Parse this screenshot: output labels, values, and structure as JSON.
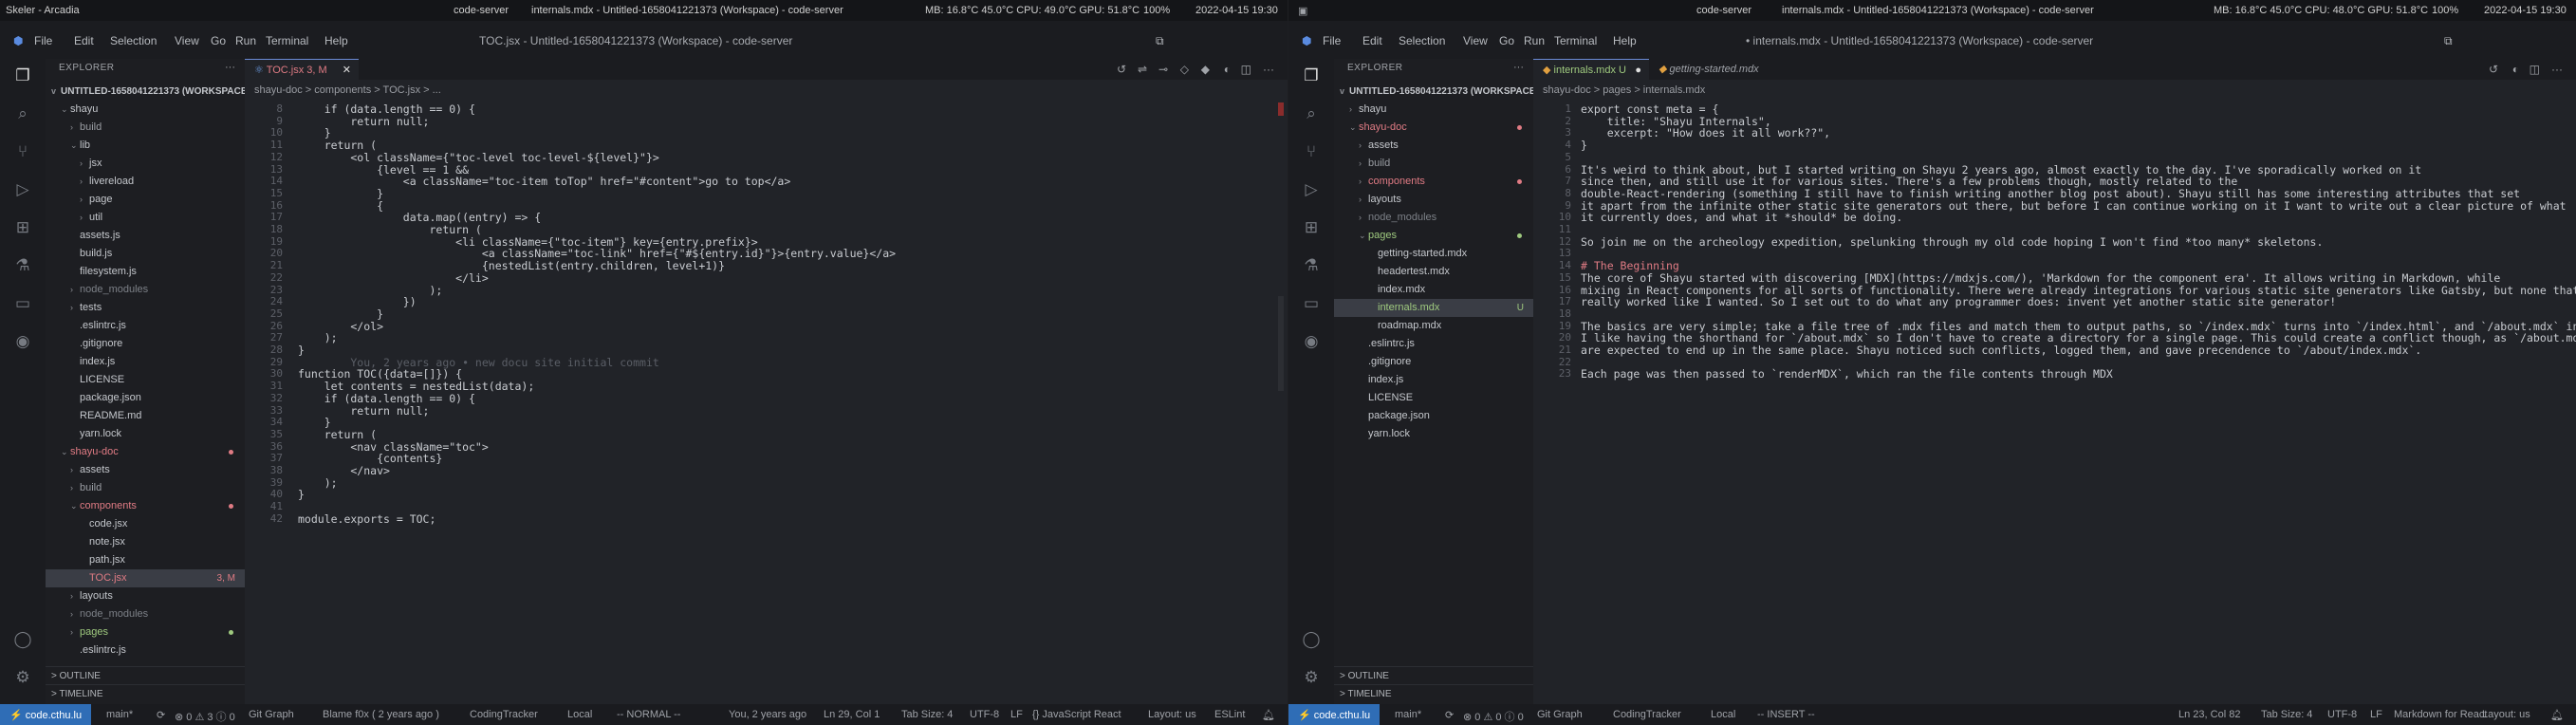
{
  "left": {
    "topbar": {
      "app": "Skeler - Arcadia",
      "window": "code-server",
      "tab_title": "internals.mdx - Untitled-1658041221373 (Workspace) - code-server",
      "stats": "MB: 16.8°C 45.0°C CPU: 49.0°C GPU: 51.8°C",
      "battery": "100%",
      "datetime": "2022-04-15 19:30"
    },
    "menu": [
      "File",
      "Edit",
      "Selection",
      "View",
      "Go",
      "Run",
      "Terminal",
      "Help"
    ],
    "window_title": "TOC.jsx - Untitled-1658041221373 (Workspace) - code-server",
    "explorer": {
      "label": "EXPLORER",
      "workspace": "UNTITLED-1658041221373 (WORKSPACE)"
    },
    "tree": [
      {
        "name": "shayu",
        "indent": 1,
        "tw": "v",
        "color": "#c4c7cc"
      },
      {
        "name": "build",
        "indent": 2,
        "tw": ">",
        "color": "#9a9da3"
      },
      {
        "name": "lib",
        "indent": 2,
        "tw": "v",
        "color": "#c4c7cc"
      },
      {
        "name": "jsx",
        "indent": 3,
        "tw": ">",
        "color": "#c4c7cc"
      },
      {
        "name": "livereload",
        "indent": 3,
        "tw": ">",
        "color": "#c4c7cc"
      },
      {
        "name": "page",
        "indent": 3,
        "tw": ">",
        "color": "#c4c7cc"
      },
      {
        "name": "util",
        "indent": 3,
        "tw": ">",
        "color": "#c4c7cc"
      },
      {
        "name": "assets.js",
        "indent": 2,
        "tw": "",
        "color": "#c4c7cc"
      },
      {
        "name": "build.js",
        "indent": 2,
        "tw": "",
        "color": "#c4c7cc"
      },
      {
        "name": "filesystem.js",
        "indent": 2,
        "tw": "",
        "color": "#c4c7cc"
      },
      {
        "name": "node_modules",
        "indent": 2,
        "tw": ">",
        "color": "#7c8087"
      },
      {
        "name": "tests",
        "indent": 2,
        "tw": ">",
        "color": "#c4c7cc"
      },
      {
        "name": ".eslintrc.js",
        "indent": 2,
        "tw": "",
        "color": "#c4c7cc"
      },
      {
        "name": ".gitignore",
        "indent": 2,
        "tw": "",
        "color": "#c4c7cc"
      },
      {
        "name": "index.js",
        "indent": 2,
        "tw": "",
        "color": "#c4c7cc"
      },
      {
        "name": "LICENSE",
        "indent": 2,
        "tw": "",
        "color": "#c4c7cc"
      },
      {
        "name": "package.json",
        "indent": 2,
        "tw": "",
        "color": "#c4c7cc"
      },
      {
        "name": "README.md",
        "indent": 2,
        "tw": "",
        "color": "#c4c7cc"
      },
      {
        "name": "yarn.lock",
        "indent": 2,
        "tw": "",
        "color": "#c4c7cc"
      },
      {
        "name": "shayu-doc",
        "indent": 1,
        "tw": "v",
        "color": "#e07b84",
        "dot": "#e07b84"
      },
      {
        "name": "assets",
        "indent": 2,
        "tw": ">",
        "color": "#c4c7cc"
      },
      {
        "name": "build",
        "indent": 2,
        "tw": ">",
        "color": "#9a9da3"
      },
      {
        "name": "components",
        "indent": 2,
        "tw": "v",
        "color": "#e07b84",
        "dot": "#e07b84"
      },
      {
        "name": "code.jsx",
        "indent": 3,
        "tw": "",
        "color": "#c4c7cc"
      },
      {
        "name": "note.jsx",
        "indent": 3,
        "tw": "",
        "color": "#c4c7cc"
      },
      {
        "name": "path.jsx",
        "indent": 3,
        "tw": "",
        "color": "#c4c7cc"
      },
      {
        "name": "TOC.jsx",
        "indent": 3,
        "tw": "",
        "color": "#e07b84",
        "badge": "3, M",
        "sel": true
      },
      {
        "name": "layouts",
        "indent": 2,
        "tw": ">",
        "color": "#c4c7cc"
      },
      {
        "name": "node_modules",
        "indent": 2,
        "tw": ">",
        "color": "#7c8087"
      },
      {
        "name": "pages",
        "indent": 2,
        "tw": ">",
        "color": "#9fca7f",
        "dot": "#9fca7f"
      },
      {
        "name": ".eslintrc.js",
        "indent": 2,
        "tw": "",
        "color": "#c4c7cc"
      }
    ],
    "outline": "OUTLINE",
    "timeline": "TIMELINE",
    "tab_active": "TOC.jsx 3, M",
    "breadcrumb": "shayu-doc > components > TOC.jsx > ...",
    "code": [
      {
        "n": "8",
        "t": "    if (data.length == 0) {"
      },
      {
        "n": "9",
        "t": "        return null;"
      },
      {
        "n": "10",
        "t": "    }"
      },
      {
        "n": "11",
        "t": "    return ("
      },
      {
        "n": "12",
        "t": "        <ol className={\"toc-level toc-level-${level}\"}>"
      },
      {
        "n": "13",
        "t": "            {level == 1 &&"
      },
      {
        "n": "14",
        "t": "                <a className=\"toc-item toTop\" href=\"#content\">go to top</a>"
      },
      {
        "n": "15",
        "t": "            }"
      },
      {
        "n": "16",
        "t": "            {"
      },
      {
        "n": "17",
        "t": "                data.map((entry) => {"
      },
      {
        "n": "18",
        "t": "                    return ("
      },
      {
        "n": "19",
        "t": "                        <li className={\"toc-item\"} key={entry.prefix}>"
      },
      {
        "n": "20",
        "t": "                            <a className=\"toc-link\" href={\"#${entry.id}\"}>{entry.value}</a>"
      },
      {
        "n": "21",
        "t": "                            {nestedList(entry.children, level+1)}"
      },
      {
        "n": "22",
        "t": "                        </li>"
      },
      {
        "n": "23",
        "t": "                    );"
      },
      {
        "n": "24",
        "t": "                })"
      },
      {
        "n": "25",
        "t": "            }"
      },
      {
        "n": "26",
        "t": "        </ol>"
      },
      {
        "n": "27",
        "t": "    );"
      },
      {
        "n": "28",
        "t": "}"
      },
      {
        "n": "29",
        "t": "        You, 2 years ago • new docu site initial commit",
        "blame": true
      },
      {
        "n": "30",
        "t": "function TOC({data=[]}) {"
      },
      {
        "n": "31",
        "t": "    let contents = nestedList(data);"
      },
      {
        "n": "32",
        "t": "    if (data.length == 0) {"
      },
      {
        "n": "33",
        "t": "        return null;"
      },
      {
        "n": "34",
        "t": "    }"
      },
      {
        "n": "35",
        "t": "    return ("
      },
      {
        "n": "36",
        "t": "        <nav className=\"toc\">"
      },
      {
        "n": "37",
        "t": "            {contents}"
      },
      {
        "n": "38",
        "t": "        </nav>"
      },
      {
        "n": "39",
        "t": "    );"
      },
      {
        "n": "40",
        "t": "}"
      },
      {
        "n": "41",
        "t": ""
      },
      {
        "n": "42",
        "t": "module.exports = TOC;"
      }
    ],
    "status": [
      "main*",
      "⊗ 0 ⚠ 3 ⓘ 0",
      "Git Graph",
      "Blame f0x ( 2 years ago )",
      "CodingTracker",
      "Local",
      "-- NORMAL --",
      "You, 2 years ago",
      "Ln 29, Col 1",
      "Tab Size: 4",
      "UTF-8",
      "LF",
      "{} JavaScript React",
      "Layout: us",
      "ESLint"
    ],
    "remote": "⚡ code.cthu.lu"
  },
  "right": {
    "topbar": {
      "window": "code-server",
      "tab_title": "internals.mdx - Untitled-1658041221373 (Workspace) - code-server",
      "stats": "MB: 16.8°C 45.0°C CPU: 48.0°C GPU: 51.8°C",
      "battery": "100%",
      "datetime": "2022-04-15 19:30"
    },
    "menu": [
      "File",
      "Edit",
      "Selection",
      "View",
      "Go",
      "Run",
      "Terminal",
      "Help"
    ],
    "window_title": "• internals.mdx - Untitled-1658041221373 (Workspace) - code-server",
    "explorer": {
      "label": "EXPLORER",
      "workspace": "UNTITLED-1658041221373 (WORKSPACE)"
    },
    "tree": [
      {
        "name": "shayu",
        "indent": 1,
        "tw": ">",
        "color": "#c4c7cc"
      },
      {
        "name": "shayu-doc",
        "indent": 1,
        "tw": "v",
        "color": "#e07b84",
        "dot": "#e07b84"
      },
      {
        "name": "assets",
        "indent": 2,
        "tw": ">",
        "color": "#c4c7cc"
      },
      {
        "name": "build",
        "indent": 2,
        "tw": ">",
        "color": "#9a9da3"
      },
      {
        "name": "components",
        "indent": 2,
        "tw": ">",
        "color": "#e07b84",
        "dot": "#e07b84"
      },
      {
        "name": "layouts",
        "indent": 2,
        "tw": ">",
        "color": "#c4c7cc"
      },
      {
        "name": "node_modules",
        "indent": 2,
        "tw": ">",
        "color": "#7c8087"
      },
      {
        "name": "pages",
        "indent": 2,
        "tw": "v",
        "color": "#9fca7f",
        "dot": "#9fca7f"
      },
      {
        "name": "getting-started.mdx",
        "indent": 3,
        "tw": "",
        "color": "#c4c7cc"
      },
      {
        "name": "headertest.mdx",
        "indent": 3,
        "tw": "",
        "color": "#c4c7cc"
      },
      {
        "name": "index.mdx",
        "indent": 3,
        "tw": "",
        "color": "#c4c7cc"
      },
      {
        "name": "internals.mdx",
        "indent": 3,
        "tw": "",
        "color": "#9fca7f",
        "badge": "U",
        "sel": true
      },
      {
        "name": "roadmap.mdx",
        "indent": 3,
        "tw": "",
        "color": "#c4c7cc"
      },
      {
        "name": ".eslintrc.js",
        "indent": 2,
        "tw": "",
        "color": "#c4c7cc"
      },
      {
        "name": ".gitignore",
        "indent": 2,
        "tw": "",
        "color": "#c4c7cc"
      },
      {
        "name": "index.js",
        "indent": 2,
        "tw": "",
        "color": "#c4c7cc"
      },
      {
        "name": "LICENSE",
        "indent": 2,
        "tw": "",
        "color": "#c4c7cc"
      },
      {
        "name": "package.json",
        "indent": 2,
        "tw": "",
        "color": "#c4c7cc"
      },
      {
        "name": "yarn.lock",
        "indent": 2,
        "tw": "",
        "color": "#c4c7cc"
      }
    ],
    "outline": "OUTLINE",
    "timeline": "TIMELINE",
    "tab_active": "internals.mdx U",
    "tab_other": "getting-started.mdx",
    "breadcrumb": "shayu-doc > pages > internals.mdx",
    "code": [
      {
        "n": "1",
        "t": "export const meta = {"
      },
      {
        "n": "2",
        "t": "    title: \"Shayu Internals\","
      },
      {
        "n": "3",
        "t": "    excerpt: \"How does it all work??\","
      },
      {
        "n": "4",
        "t": "}"
      },
      {
        "n": "5",
        "t": ""
      },
      {
        "n": "6",
        "t": "It's weird to think about, but I started writing on Shayu 2 years ago, almost exactly to the day. I've sporadically worked on it"
      },
      {
        "n": "7",
        "t": "since then, and still use it for various sites. There's a few problems though, mostly related to the"
      },
      {
        "n": "8",
        "t": "double-React-rendering (something I still have to finish writing another blog post about). Shayu still has some interesting attributes that set"
      },
      {
        "n": "9",
        "t": "it apart from the infinite other static site generators out there, but before I can continue working on it I want to write out a clear picture of what"
      },
      {
        "n": "10",
        "t": "it currently does, and what it *should* be doing."
      },
      {
        "n": "11",
        "t": ""
      },
      {
        "n": "12",
        "t": "So join me on the archeology expedition, spelunking through my old code hoping I won't find *too many* skeletons."
      },
      {
        "n": "13",
        "t": ""
      },
      {
        "n": "14",
        "t": "# The Beginning"
      },
      {
        "n": "15",
        "t": "The core of Shayu started with discovering [MDX](https://mdxjs.com/), 'Markdown for the component era'. It allows writing in Markdown, while"
      },
      {
        "n": "16",
        "t": "mixing in React components for all sorts of functionality. There were already integrations for various static site generators like Gatsby, but none that"
      },
      {
        "n": "17",
        "t": "really worked like I wanted. So I set out to do what any programmer does: invent yet another static site generator!"
      },
      {
        "n": "18",
        "t": ""
      },
      {
        "n": "19",
        "t": "The basics are very simple; take a file tree of .mdx files and match them to output paths, so `/index.mdx` turns into `/index.html`, and `/about.mdx` into `/about/"
      },
      {
        "n": "20",
        "t": "I like having the shorthand for `/about.mdx` so I don't have to create a directory for a single page. This could create a conflict though, as `/about.mdx` and `/a"
      },
      {
        "n": "21",
        "t": "are expected to end up in the same place. Shayu noticed such conflicts, logged them, and gave precendence to `/about/index.mdx`."
      },
      {
        "n": "22",
        "t": ""
      },
      {
        "n": "23",
        "t": "Each page was then passed to `renderMDX`, which ran the file contents through MDX"
      }
    ],
    "status": [
      "main*",
      "⊗ 0 ⚠ 0 ⓘ 0",
      "Git Graph",
      "CodingTracker",
      "Local",
      "-- INSERT --",
      "Ln 23, Col 82",
      "Tab Size: 4",
      "UTF-8",
      "LF",
      "Markdown for React",
      "Layout: us"
    ],
    "remote": "⚡ code.cthu.lu"
  }
}
